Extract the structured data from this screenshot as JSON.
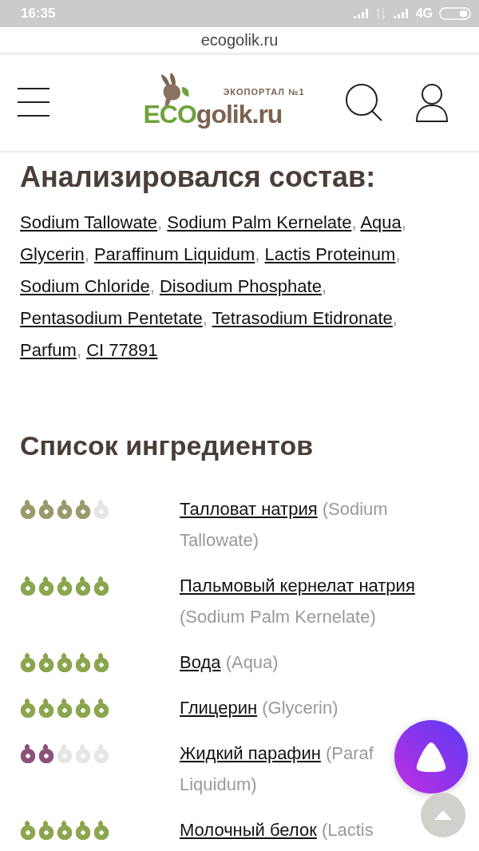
{
  "status_bar": {
    "time": "16:35",
    "network": "4G"
  },
  "address_bar": {
    "url": "ecogolik.ru"
  },
  "logo": {
    "tagline": "ЭКОПОРТАЛ №1",
    "eco": "ECO",
    "rest": "golik.ru"
  },
  "composition": {
    "title": "Анализировался состав:",
    "separator": ",",
    "links": [
      "Sodium Tallowate",
      "Sodium Palm Kernelate",
      "Aqua",
      "Glycerin",
      "Paraffinum Liquidum",
      "Lactis Proteinum",
      "Sodium Chloride",
      "Disodium Phosphate",
      "Pentasodium Pentetate",
      "Tetrasodium Etidronate",
      "Parfum",
      "CI 77891"
    ]
  },
  "ingredients": {
    "title": "Список ингредиентов",
    "items": [
      {
        "stars": 4,
        "color": "#9b9a6c",
        "name": "Талловат натрия",
        "latin": "(Sodium Tallowate)"
      },
      {
        "stars": 5,
        "color": "#8aa64e",
        "name": "Пальмовый кернелат натрия",
        "latin": "(Sodium Palm Kernelate)"
      },
      {
        "stars": 5,
        "color": "#8aa64e",
        "name": "Вода",
        "latin": "(Aqua)"
      },
      {
        "stars": 5,
        "color": "#8aa64e",
        "name": "Глицерин",
        "latin": "(Glycerin)"
      },
      {
        "stars": 2,
        "color": "#8c5379",
        "name": "Жидкий парафин",
        "latin": "(Paraf",
        "latin_continued": "Liquidum)"
      },
      {
        "stars": 5,
        "color": "#8aa64e",
        "name": "Молочный белок",
        "latin": "(Lactis"
      }
    ]
  }
}
